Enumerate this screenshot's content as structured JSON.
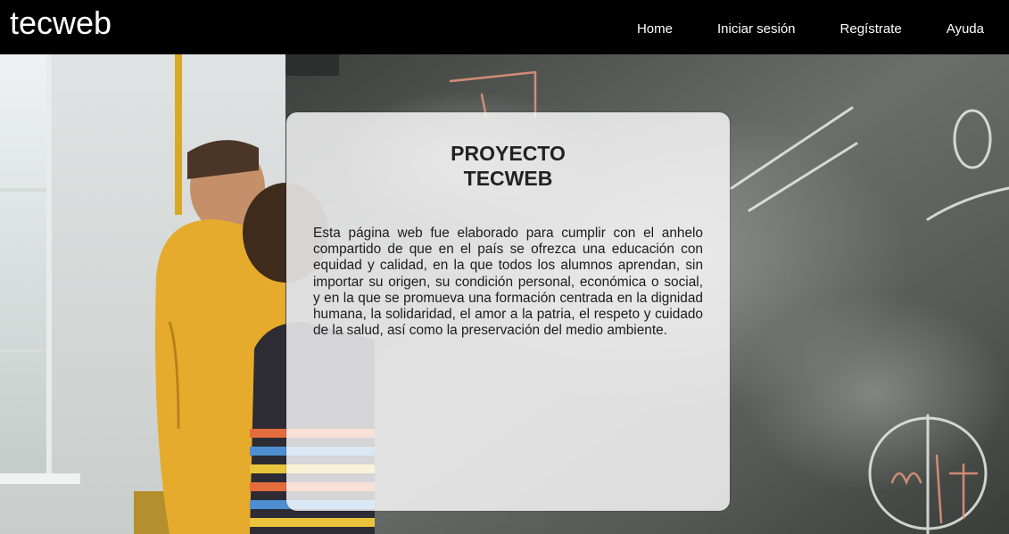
{
  "header": {
    "brand": "tecweb",
    "nav": [
      {
        "label": "Home"
      },
      {
        "label": "Iniciar sesión"
      },
      {
        "label": "Regístrate"
      },
      {
        "label": "Ayuda"
      }
    ]
  },
  "card": {
    "title_line1": "PROYECTO",
    "title_line2": "TECWEB",
    "body": "Esta página web fue elaborado para cumplir con el anhelo compartido de que en el país se ofrezca una educación con equidad y calidad, en la que todos los alumnos aprendan, sin importar su origen, su condición personal, económica o social, y en la que se promueva una formación centrada en la dignidad humana, la solidaridad, el amor a la patria, el respeto y cuidado de la salud, así como la preservación del medio ambiente."
  },
  "hero_image": {
    "subject": "classroom-chalkboard-photo",
    "chalk_formula": "m²/4"
  },
  "colors": {
    "navbar": "#000000",
    "nav_text": "#ffffff",
    "card_bg": "rgba(255,255,255,0.80)",
    "title_text": "#222222"
  }
}
